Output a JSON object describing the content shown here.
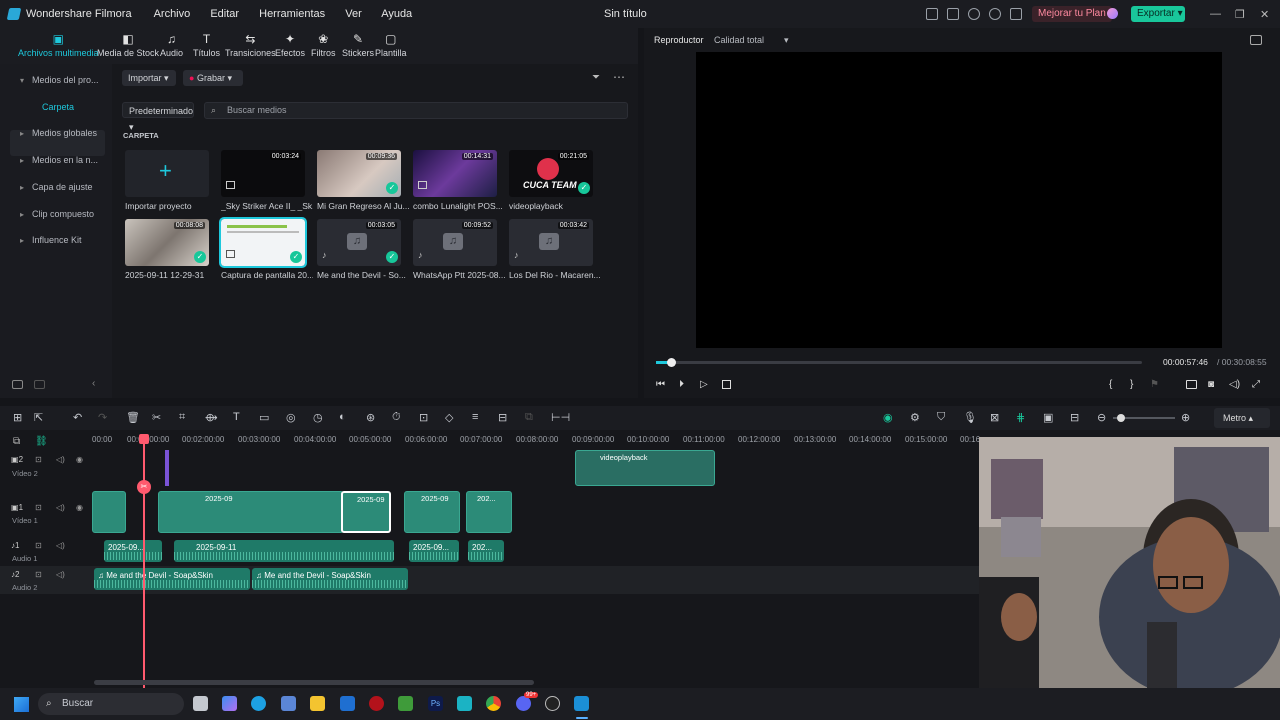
{
  "app": {
    "name": "Wondershare Filmora",
    "document_title": "Sin título"
  },
  "menu": [
    "Archivo",
    "Editar",
    "Herramientas",
    "Ver",
    "Ayuda"
  ],
  "header_buttons": {
    "upgrade": "Mejorar tu Plan",
    "export": "Exportar"
  },
  "toolbar": [
    {
      "label": "Archivos multimedia",
      "icon": "media-folder-icon",
      "active": true
    },
    {
      "label": "Media de Stock",
      "icon": "stock-icon"
    },
    {
      "label": "Audio",
      "icon": "music-note-icon"
    },
    {
      "label": "Títulos",
      "icon": "text-icon"
    },
    {
      "label": "Transiciones",
      "icon": "transition-icon"
    },
    {
      "label": "Efectos",
      "icon": "effects-icon"
    },
    {
      "label": "Filtros",
      "icon": "filters-icon"
    },
    {
      "label": "Stickers",
      "icon": "stickers-icon"
    },
    {
      "label": "Plantilla",
      "icon": "template-icon"
    }
  ],
  "sidebar": {
    "items": [
      {
        "label": "Medios del pro..."
      },
      {
        "label": "Carpeta",
        "selected": true
      },
      {
        "label": "Medios globales"
      },
      {
        "label": "Medios en la n..."
      },
      {
        "label": "Capa de ajuste"
      },
      {
        "label": "Clip compuesto"
      },
      {
        "label": "Influence Kit"
      }
    ]
  },
  "media": {
    "import_label": "Importar",
    "record_label": "Grabar",
    "sort_label": "Predeterminado",
    "search_placeholder": "Buscar medios",
    "section_title": "CARPETA",
    "items": [
      {
        "name": "Importar proyecto",
        "type": "import"
      },
      {
        "name": "_Sky Striker Ace II_ _Sk...",
        "duration": "00:03:24",
        "type": "video"
      },
      {
        "name": "Mi Gran Regreso Al Ju...",
        "duration": "00:09:36",
        "type": "video",
        "used": true
      },
      {
        "name": "combo Lunalight POS...",
        "duration": "00:14:31",
        "type": "video"
      },
      {
        "name": "videoplayback",
        "duration": "00:21:05",
        "type": "video",
        "used": true
      },
      {
        "name": "2025-09-11 12-29-31",
        "duration": "00:08:08",
        "type": "video",
        "used": true
      },
      {
        "name": "Captura de pantalla 20...",
        "type": "image",
        "used": true,
        "selected": true
      },
      {
        "name": "Me and the Devil - So...",
        "duration": "00:03:05",
        "type": "audio",
        "used": true
      },
      {
        "name": "WhatsApp Ptt 2025-08...",
        "duration": "00:09:52",
        "type": "audio"
      },
      {
        "name": "Los Del Rio - Macaren...",
        "duration": "00:03:42",
        "type": "audio"
      }
    ]
  },
  "player": {
    "tab_label": "Reproductor",
    "quality_label": "Calidad total",
    "current_time": "00:00:57:46",
    "total_time": "/ 00:30:08:55",
    "progress": 0.03
  },
  "timeline": {
    "ruler": [
      "00:00",
      "00:01:00:00",
      "00:02:00:00",
      "00:03:00:00",
      "00:04:00:00",
      "00:05:00:00",
      "00:06:00:00",
      "00:07:00:00",
      "00:08:00:00",
      "00:09:00:00",
      "00:10:00:00",
      "00:11:00:00",
      "00:12:00:00",
      "00:13:00:00",
      "00:14:00:00",
      "00:15:00:00",
      "00:16"
    ],
    "meter_label": "Metro",
    "tracks": {
      "video2": {
        "num": "2",
        "label": "Vídeo 2"
      },
      "video1": {
        "num": "1",
        "label": "Vídeo 1"
      },
      "audio1": {
        "num": "1",
        "label": "Audio 1"
      },
      "audio2": {
        "num": "2",
        "label": "Audio 2"
      }
    },
    "clips": {
      "video2_clip": "videoplayback",
      "video1_clip": "2025-09",
      "video1_clip_b": "202...",
      "audio1_clip": "2025-09-11",
      "audio1_clip_b": "2025-09...",
      "audio1_clip_c": "202...",
      "audio2_clip_a": "Me and the Devil - Soap&Skin",
      "audio2_clip_b": "Me and the Devil - Soap&Skin"
    }
  },
  "taskbar": {
    "search_label": "Buscar",
    "badge": "99+"
  }
}
